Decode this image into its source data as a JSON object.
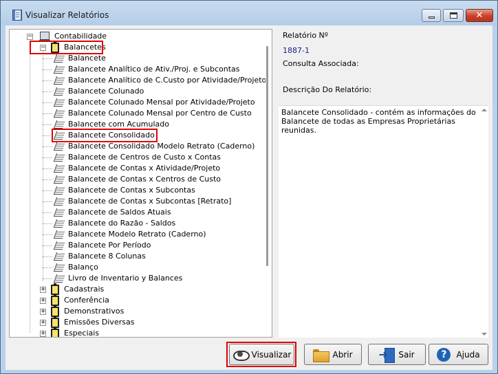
{
  "window": {
    "title": "Visualizar Relatórios"
  },
  "tree": {
    "root": {
      "label": "Contabilidade",
      "icon": "computer-icon"
    },
    "expanded_group": {
      "label": "Balancetes",
      "icon": "folder-icon"
    },
    "reports": [
      "Balancete",
      "Balancete Analítico de Ativ./Proj. e Subcontas",
      "Balancete Analítico de C.Custo por Atividade/Projeto",
      "Balancete Colunado",
      "Balancete Colunado Mensal por Atividade/Projeto",
      "Balancete Colunado Mensal por Centro de Custo",
      "Balancete com Acumulado",
      "Balancete Consolidado",
      "Balancete Consolidado Modelo Retrato (Caderno)",
      "Balancete de Centros de Custo x Contas",
      "Balancete de Contas x Atividade/Projeto",
      "Balancete de Contas x Centros de Custo",
      "Balancete de Contas x Subcontas",
      "Balancete de Contas x Subcontas [Retrato]",
      "Balancete de Saldos Atuais",
      "Balancete do Razão - Saldos",
      "Balancete Modelo Retrato (Caderno)",
      "Balancete Por Período",
      "Balancete 8 Colunas",
      "Balanço",
      "Livro de Inventario y Balances"
    ],
    "selected_report": "Balancete Consolidado",
    "collapsed_groups": [
      "Cadastrais",
      "Conferência",
      "Demonstrativos",
      "Emissões Diversas",
      "Especiais"
    ]
  },
  "details": {
    "report_number_label": "Relatório Nº",
    "report_number_value": "1887-1",
    "associated_query_label": "Consulta Associada:",
    "description_label": "Descrição Do Relatório:",
    "description_text": "Balancete Consolidado - contém as informações do Balancete de todas as Empresas Proprietárias reunidas."
  },
  "buttons": {
    "view": "Visualizar",
    "open": "Abrir",
    "exit": "Sair",
    "help": "Ajuda"
  },
  "colors": {
    "highlight": "#e00000",
    "frame": "#b9d1ea",
    "close_button": "#c7402b"
  }
}
